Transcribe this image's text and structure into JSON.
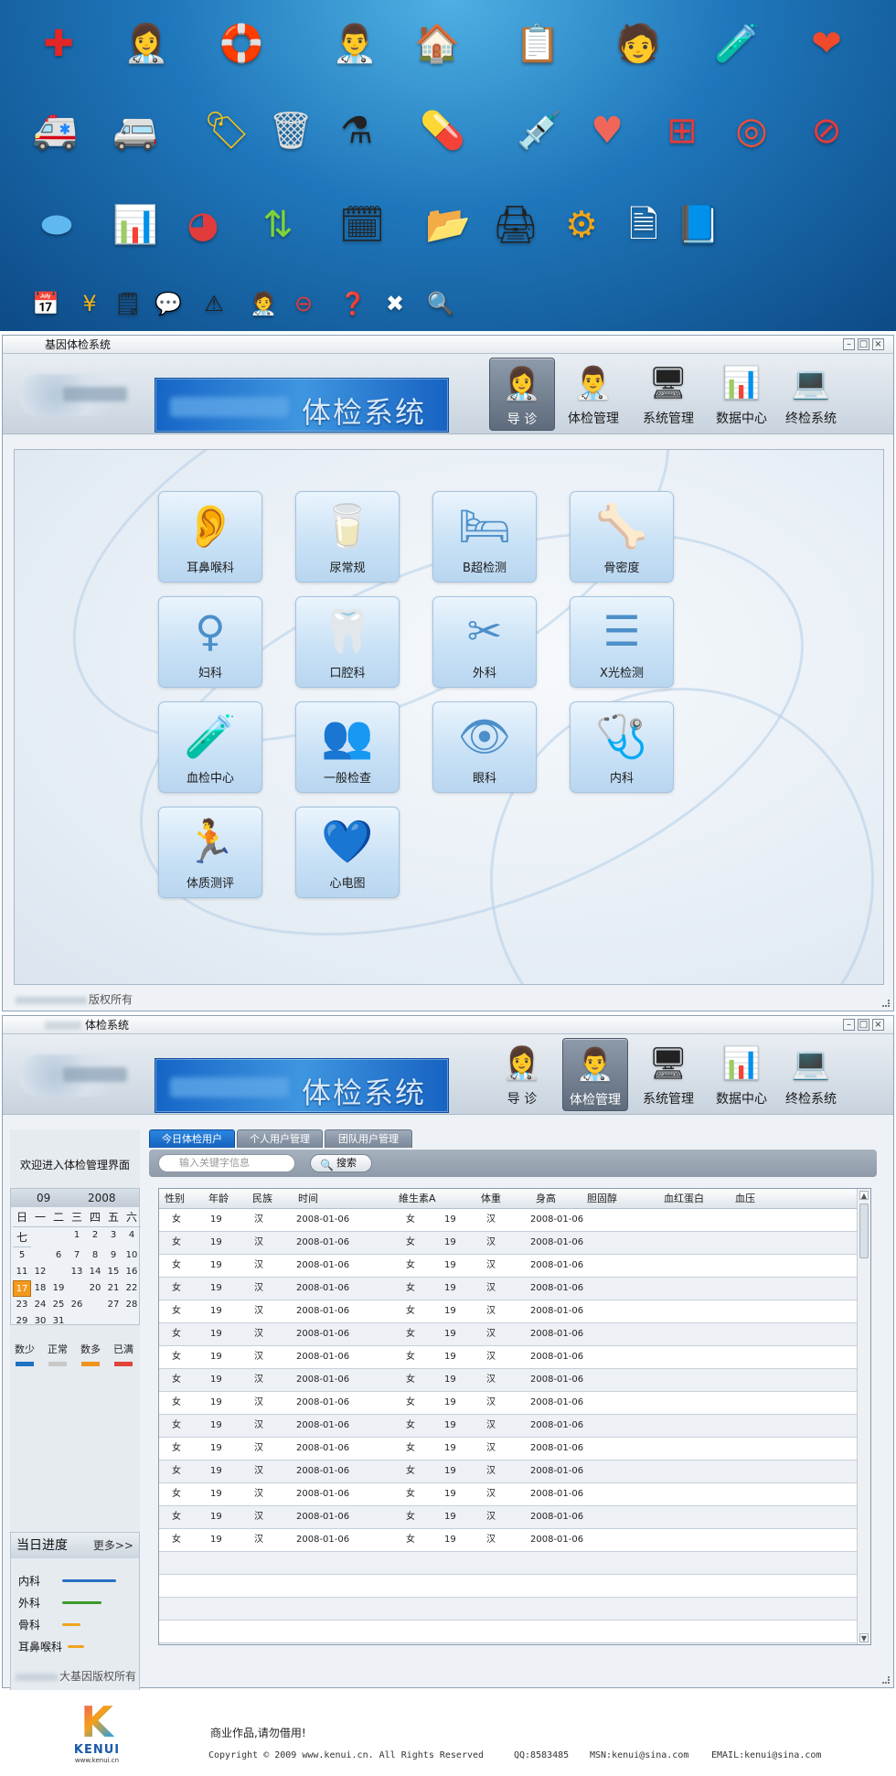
{
  "showcase": {
    "row1": [
      "red-cross-icon",
      "nurse-icon",
      "nurse-lifebuoy-icon",
      "doctor-icon",
      "hospital-icon",
      "notepad-icon",
      "doctor-record-icon",
      "test-tubes-icon",
      "heart-icon"
    ],
    "row2": [
      "ambulance-front-icon",
      "ambulance-icon",
      "medicine-tag-icon",
      "trash-bin-icon",
      "flask-icon",
      "capsule-icon",
      "syringe-icon",
      "heart-cross-icon",
      "first-aid-icon",
      "lifebuoy-icon",
      "forbidden-icon"
    ],
    "row3": [
      "disk-icon",
      "bar-chart-icon",
      "pie-chart-icon",
      "up-down-arrows-icon",
      "calendar-clock-icon",
      "folder-icon",
      "printer-icon",
      "gear-icon",
      "document-icon",
      "notebook-icon"
    ],
    "row4": [
      "calendar-icon",
      "currency-icon",
      "day-calendar-icon",
      "medicine-note-icon",
      "warning-icon",
      "doctor-small-icon",
      "minus-circle-icon",
      "help-icon",
      "close-circle-icon",
      "magnifier-icon"
    ]
  },
  "window1": {
    "title": "基因体检系统",
    "banner_title": "体检系统",
    "nav": [
      {
        "label": "导  诊",
        "icon": "nurse-icon"
      },
      {
        "label": "体检管理",
        "icon": "doctor-icon"
      },
      {
        "label": "系统管理",
        "icon": "settings-icon"
      },
      {
        "label": "数据中心",
        "icon": "data-icon"
      },
      {
        "label": "终检系统",
        "icon": "monitor-icon"
      }
    ],
    "departments": [
      "耳鼻喉科",
      "尿常规",
      "B超检测",
      "骨密度",
      "妇科",
      "口腔科",
      "外科",
      "X光检测",
      "血检中心",
      "一般检查",
      "眼科",
      "内科",
      "体质测评",
      "心电图"
    ],
    "footer": "版权所有"
  },
  "window2": {
    "title": "体检系统",
    "banner_title": "体检系统",
    "nav": [
      {
        "label": "导  诊",
        "icon": "nurse-icon"
      },
      {
        "label": "体检管理",
        "icon": "doctor-icon"
      },
      {
        "label": "系统管理",
        "icon": "settings-icon"
      },
      {
        "label": "数据中心",
        "icon": "data-icon"
      },
      {
        "label": "终检系统",
        "icon": "monitor-icon"
      }
    ],
    "welcome": "欢迎进入体检管理界面",
    "calendar": {
      "month": "09",
      "year": "2008",
      "weekdays": [
        "日",
        "一",
        "二",
        "三",
        "四",
        "五",
        "六",
        "七"
      ],
      "days": [
        [
          "",
          "",
          "1",
          "2",
          "3",
          "4",
          "5"
        ],
        [
          "6",
          "7",
          "8",
          "9",
          "10",
          "11",
          "12"
        ],
        [
          "13",
          "14",
          "15",
          "16",
          "17",
          "18",
          "19"
        ],
        [
          "20",
          "21",
          "22",
          "23",
          "24",
          "25",
          "26"
        ],
        [
          "27",
          "28",
          "29",
          "30",
          "31",
          "",
          ""
        ]
      ],
      "today": "17"
    },
    "legend": [
      {
        "label": "数少",
        "color": "#1f6fc2"
      },
      {
        "label": "正常",
        "color": "#c8c8c8"
      },
      {
        "label": "数多",
        "color": "#f0921e"
      },
      {
        "label": "已满",
        "color": "#e0443a"
      }
    ],
    "progress": {
      "title": "当日进度",
      "more": "更多>>",
      "items": [
        {
          "label": "内科",
          "value": 0.9,
          "color": "#2a6fc6"
        },
        {
          "label": "外科",
          "value": 0.65,
          "color": "#3a9a2a"
        },
        {
          "label": "骨科",
          "value": 0.3,
          "color": "#f0a41e"
        },
        {
          "label": "耳鼻喉科",
          "value": 0.28,
          "color": "#f0a41e"
        }
      ]
    },
    "tabs": [
      "今日体检用户",
      "个人用户管理",
      "团队用户管理"
    ],
    "search": {
      "placeholder": "输入关键字信息",
      "button": "搜索"
    },
    "columns": [
      "性别",
      "年龄",
      "民族",
      "时间",
      "維生素A",
      "体重",
      "身高",
      "胆固醇",
      "血红蛋白",
      "血压"
    ],
    "rows": [
      [
        "女",
        "19",
        "汉",
        "2008-01-06",
        "女",
        "19",
        "汉",
        "2008-01-06"
      ],
      [
        "女",
        "19",
        "汉",
        "2008-01-06",
        "女",
        "19",
        "汉",
        "2008-01-06"
      ],
      [
        "女",
        "19",
        "汉",
        "2008-01-06",
        "女",
        "19",
        "汉",
        "2008-01-06"
      ],
      [
        "女",
        "19",
        "汉",
        "2008-01-06",
        "女",
        "19",
        "汉",
        "2008-01-06"
      ],
      [
        "女",
        "19",
        "汉",
        "2008-01-06",
        "女",
        "19",
        "汉",
        "2008-01-06"
      ],
      [
        "女",
        "19",
        "汉",
        "2008-01-06",
        "女",
        "19",
        "汉",
        "2008-01-06"
      ],
      [
        "女",
        "19",
        "汉",
        "2008-01-06",
        "女",
        "19",
        "汉",
        "2008-01-06"
      ],
      [
        "女",
        "19",
        "汉",
        "2008-01-06",
        "女",
        "19",
        "汉",
        "2008-01-06"
      ],
      [
        "女",
        "19",
        "汉",
        "2008-01-06",
        "女",
        "19",
        "汉",
        "2008-01-06"
      ],
      [
        "女",
        "19",
        "汉",
        "2008-01-06",
        "女",
        "19",
        "汉",
        "2008-01-06"
      ],
      [
        "女",
        "19",
        "汉",
        "2008-01-06",
        "女",
        "19",
        "汉",
        "2008-01-06"
      ],
      [
        "女",
        "19",
        "汉",
        "2008-01-06",
        "女",
        "19",
        "汉",
        "2008-01-06"
      ],
      [
        "女",
        "19",
        "汉",
        "2008-01-06",
        "女",
        "19",
        "汉",
        "2008-01-06"
      ],
      [
        "女",
        "19",
        "汉",
        "2008-01-06",
        "女",
        "19",
        "汉",
        "2008-01-06"
      ],
      [
        "女",
        "19",
        "汉",
        "2008-01-06",
        "女",
        "19",
        "汉",
        "2008-01-06"
      ]
    ],
    "footer": "大基因版权所有"
  },
  "bottom": {
    "brand": "KENUI",
    "site": "www.kenui.cn",
    "note": "商业作品,请勿借用!",
    "copyright": "Copyright © 2009 www.kenui.cn. All Rights Reserved",
    "qq": "QQ:8583485",
    "msn": "MSN:kenui@sina.com",
    "email": "EMAIL:kenui@sina.com"
  }
}
